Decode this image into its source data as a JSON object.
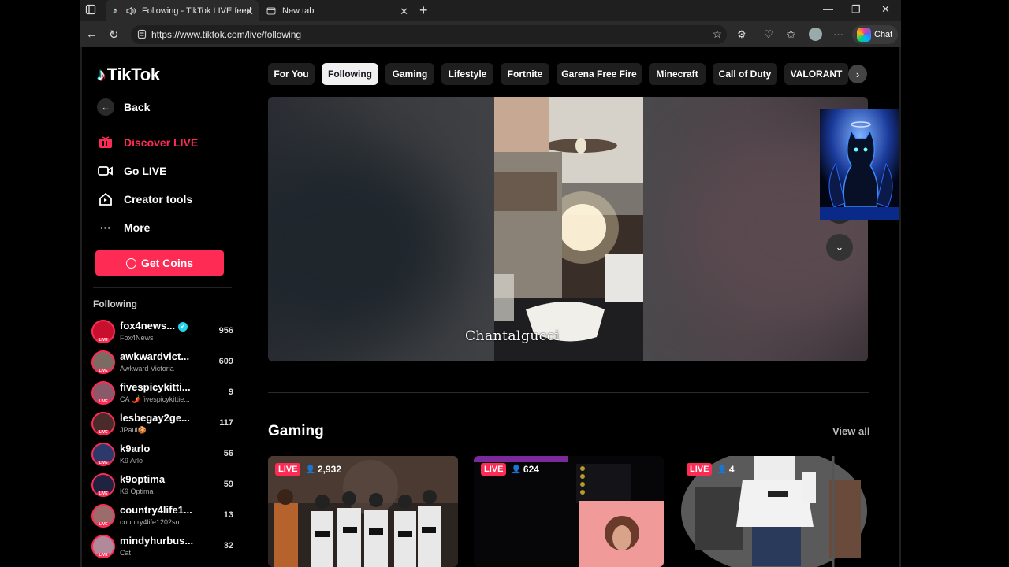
{
  "browser": {
    "tabs": [
      {
        "title": "Following - TikTok LIVE feed",
        "active": true
      },
      {
        "title": "New tab",
        "active": false
      }
    ],
    "url": "https://www.tiktok.com/live/following",
    "chat_label": "Chat"
  },
  "sidebar": {
    "logo": "TikTok",
    "back_label": "Back",
    "nav": [
      {
        "label": "Discover LIVE",
        "icon": "live-tv-icon",
        "active": true
      },
      {
        "label": "Go LIVE",
        "icon": "video-camera-icon",
        "active": false
      },
      {
        "label": "Creator tools",
        "icon": "creator-home-icon",
        "active": false
      },
      {
        "label": "More",
        "icon": "more-dots-icon",
        "active": false
      }
    ],
    "get_coins_label": "Get Coins",
    "following_heading": "Following",
    "following": [
      {
        "username": "fox4news...",
        "display": "Fox4News",
        "count": "956",
        "verified": true,
        "avatar_color": "#c8102e"
      },
      {
        "username": "awkwardvict...",
        "display": "Awkward Victoria",
        "count": "609",
        "verified": false,
        "avatar_color": "#7d6b63"
      },
      {
        "username": "fivespicykitti...",
        "display": "CA 🌶️ fivespicykittie...",
        "count": "9",
        "verified": false,
        "avatar_color": "#8a5a6b"
      },
      {
        "username": "lesbegay2ge...",
        "display": "JPaul🍪",
        "count": "117",
        "verified": false,
        "avatar_color": "#4a2b2b"
      },
      {
        "username": "k9arlo",
        "display": "K9 Arlo",
        "count": "56",
        "verified": false,
        "avatar_color": "#2b3a6b"
      },
      {
        "username": "k9optima",
        "display": "K9 Optima",
        "count": "59",
        "verified": false,
        "avatar_color": "#1f2240"
      },
      {
        "username": "country4life1...",
        "display": "country4life1202sn...",
        "count": "13",
        "verified": false,
        "avatar_color": "#9c6b6b"
      },
      {
        "username": "mindyhurbus...",
        "display": "Cat",
        "count": "32",
        "verified": false,
        "avatar_color": "#b08a9a"
      }
    ]
  },
  "categories": [
    "For You",
    "Following",
    "Gaming",
    "Lifestyle",
    "Fortnite",
    "Garena Free Fire",
    "Minecraft",
    "Call of Duty",
    "VALORANT"
  ],
  "selected_category": "Following",
  "player": {
    "streamer_name": "Chantalgucci"
  },
  "gaming_section": {
    "title": "Gaming",
    "view_all": "View all",
    "cards": [
      {
        "live_label": "LIVE",
        "viewers": "2,932"
      },
      {
        "live_label": "LIVE",
        "viewers": "624"
      },
      {
        "live_label": "LIVE",
        "viewers": "4"
      }
    ]
  },
  "colors": {
    "accent": "#fe2c55",
    "background": "#000000",
    "pill": "#1e1e1e"
  }
}
